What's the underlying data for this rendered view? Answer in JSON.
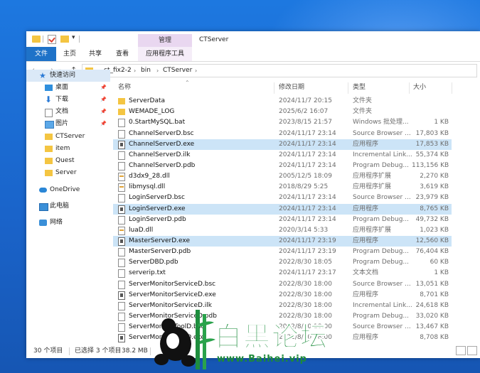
{
  "window": {
    "title": "CTServer",
    "context_tab_header": "管理"
  },
  "ribbon": {
    "tabs": [
      "文件",
      "主页",
      "共享",
      "查看",
      "应用程序工具"
    ]
  },
  "address": {
    "breadcrumbs": [
      "ct_fix2-2",
      "bin",
      "CTServer"
    ],
    "sep": "›"
  },
  "sidebar": {
    "items": [
      {
        "label": "快速访问",
        "icon": "star-icon"
      },
      {
        "label": "桌面",
        "icon": "desktop-icon",
        "pinned": true
      },
      {
        "label": "下载",
        "icon": "download-icon",
        "pinned": true
      },
      {
        "label": "文档",
        "icon": "documents-icon",
        "pinned": true
      },
      {
        "label": "图片",
        "icon": "pictures-icon",
        "pinned": true
      },
      {
        "label": "CTServer",
        "icon": "folder-icon"
      },
      {
        "label": "item",
        "icon": "folder-icon"
      },
      {
        "label": "Quest",
        "icon": "folder-icon"
      },
      {
        "label": "Server",
        "icon": "folder-icon"
      },
      {
        "label": "OneDrive",
        "icon": "cloud-icon"
      },
      {
        "label": "此电脑",
        "icon": "computer-icon"
      },
      {
        "label": "网络",
        "icon": "network-icon"
      }
    ]
  },
  "columns": {
    "name": "名称",
    "date": "修改日期",
    "type": "类型",
    "size": "大小"
  },
  "files": [
    {
      "name": "ServerData",
      "date": "2024/11/7 20:15",
      "type": "文件夹",
      "size": "",
      "icon": "folder-icon",
      "selected": false
    },
    {
      "name": "WEMADE_LOG",
      "date": "2025/6/2 16:07",
      "type": "文件夹",
      "size": "",
      "icon": "folder-icon",
      "selected": false
    },
    {
      "name": "0.StartMySQL.bat",
      "date": "2023/8/15 21:57",
      "type": "Windows 批处理...",
      "size": "1 KB",
      "icon": "file-icon",
      "selected": false
    },
    {
      "name": "ChannelServerD.bsc",
      "date": "2024/11/17 23:14",
      "type": "Source Browser ...",
      "size": "17,803 KB",
      "icon": "file-icon",
      "selected": false
    },
    {
      "name": "ChannelServerD.exe",
      "date": "2024/11/17 23:14",
      "type": "应用程序",
      "size": "17,853 KB",
      "icon": "exe-icon",
      "selected": true
    },
    {
      "name": "ChannelServerD.ilk",
      "date": "2024/11/17 23:14",
      "type": "Incremental Link...",
      "size": "55,374 KB",
      "icon": "file-icon",
      "selected": false
    },
    {
      "name": "ChannelServerD.pdb",
      "date": "2024/11/17 23:14",
      "type": "Program Debug...",
      "size": "113,156 KB",
      "icon": "file-icon",
      "selected": false
    },
    {
      "name": "d3dx9_28.dll",
      "date": "2005/12/5 18:09",
      "type": "应用程序扩展",
      "size": "2,270 KB",
      "icon": "dll-icon",
      "selected": false
    },
    {
      "name": "libmysql.dll",
      "date": "2018/8/29 5:25",
      "type": "应用程序扩展",
      "size": "3,619 KB",
      "icon": "dll-icon",
      "selected": false
    },
    {
      "name": "LoginServerD.bsc",
      "date": "2024/11/17 23:14",
      "type": "Source Browser ...",
      "size": "23,979 KB",
      "icon": "file-icon",
      "selected": false
    },
    {
      "name": "LoginServerD.exe",
      "date": "2024/11/17 23:14",
      "type": "应用程序",
      "size": "8,765 KB",
      "icon": "exe-icon",
      "selected": true
    },
    {
      "name": "LoginServerD.pdb",
      "date": "2024/11/17 23:14",
      "type": "Program Debug...",
      "size": "49,732 KB",
      "icon": "file-icon",
      "selected": false
    },
    {
      "name": "luaD.dll",
      "date": "2020/3/14 5:33",
      "type": "应用程序扩展",
      "size": "1,023 KB",
      "icon": "dll-icon",
      "selected": false
    },
    {
      "name": "MasterServerD.exe",
      "date": "2024/11/17 23:19",
      "type": "应用程序",
      "size": "12,560 KB",
      "icon": "exe-icon",
      "selected": true
    },
    {
      "name": "MasterServerD.pdb",
      "date": "2024/11/17 23:19",
      "type": "Program Debug...",
      "size": "76,404 KB",
      "icon": "file-icon",
      "selected": false
    },
    {
      "name": "ServerDBD.pdb",
      "date": "2022/8/30 18:05",
      "type": "Program Debug...",
      "size": "60 KB",
      "icon": "file-icon",
      "selected": false
    },
    {
      "name": "serverip.txt",
      "date": "2024/11/17 23:17",
      "type": "文本文档",
      "size": "1 KB",
      "icon": "file-icon",
      "selected": false
    },
    {
      "name": "ServerMonitorServiceD.bsc",
      "date": "2022/8/30 18:00",
      "type": "Source Browser ...",
      "size": "13,051 KB",
      "icon": "file-icon",
      "selected": false
    },
    {
      "name": "ServerMonitorServiceD.exe",
      "date": "2022/8/30 18:00",
      "type": "应用程序",
      "size": "8,701 KB",
      "icon": "exe-icon",
      "selected": false
    },
    {
      "name": "ServerMonitorServiceD.ilk",
      "date": "2022/8/30 18:00",
      "type": "Incremental Link...",
      "size": "24,618 KB",
      "icon": "file-icon",
      "selected": false
    },
    {
      "name": "ServerMonitorServiceD.pdb",
      "date": "2022/8/30 18:00",
      "type": "Program Debug...",
      "size": "33,020 KB",
      "icon": "file-icon",
      "selected": false
    },
    {
      "name": "ServerMonitorToolD.bsc",
      "date": "2022/8/30 18:00",
      "type": "Source Browser ...",
      "size": "13,467 KB",
      "icon": "file-icon",
      "selected": false
    },
    {
      "name": "ServerMonitorToolD.exe",
      "date": "2022/8/30 18:00",
      "type": "应用程序",
      "size": "8,708 KB",
      "icon": "exe-icon",
      "selected": false
    }
  ],
  "status": {
    "count": "30 个项目",
    "selection": "已选择 3 个项目",
    "size": "38.2 MB"
  },
  "watermark": {
    "text": "白黑论坛",
    "url": "www.Baihei.vip"
  },
  "colors": {
    "accent": "#1e72c8",
    "selection": "#cce4f7",
    "folder": "#f4c542",
    "watermark": "#1e8e3e"
  }
}
